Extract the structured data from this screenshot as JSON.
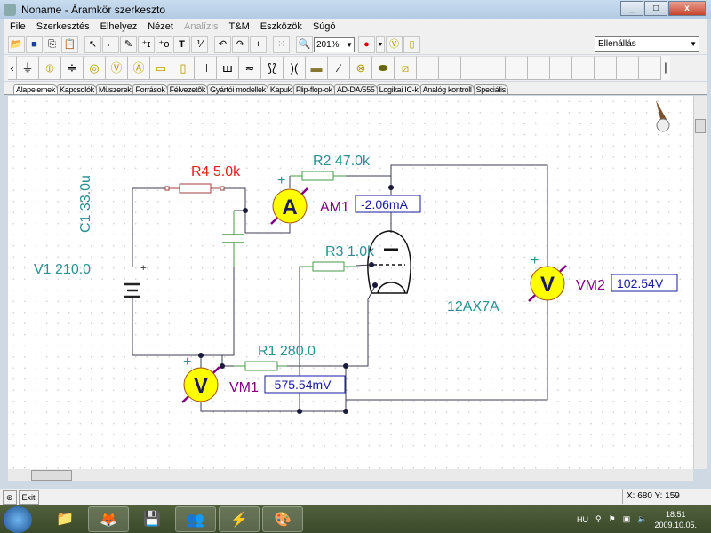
{
  "window": {
    "title": "Noname - Áramkör szerkeszto"
  },
  "menu": [
    "File",
    "Szerkesztés",
    "Elhelyez",
    "Nézet",
    "Analízis",
    "T&M",
    "Eszközök",
    "Súgó"
  ],
  "menu_disabled": [
    "Analízis"
  ],
  "toolbar": {
    "zoom": "201%",
    "component_select": "Ellenállás"
  },
  "component_tabs": [
    "Alapelemek",
    "Kapcsolók",
    "Müszerek",
    "Források",
    "Félvezetõk",
    "Gyártói modellek",
    "Kapuk",
    "Flip-flop-ok",
    "AD-DA/555",
    "Logikai IC-k",
    "Analóg kontroll",
    "Speciális"
  ],
  "active_tab": "Alapelemek",
  "circuit": {
    "R4": "R4 5.0k",
    "R2": "R2 47.0k",
    "R3": "R3 1.0k",
    "R1": "R1 280.0",
    "C1": "C1 33.0u",
    "V1": "V1 210.0",
    "tube": "12AX7A",
    "AM1": {
      "label": "AM1",
      "value": "-2.06mA",
      "symbol": "A"
    },
    "VM1": {
      "label": "VM1",
      "value": "-575.54mV",
      "symbol": "V"
    },
    "VM2": {
      "label": "VM2",
      "value": "102.54V",
      "symbol": "V"
    },
    "colors": {
      "wire": "#3c3c50",
      "component_label": "#2a9090",
      "selected_label": "#e02020",
      "meter_label": "#800080",
      "value_text": "#1a1aa0",
      "meter_fill": "#ffff00"
    }
  },
  "status": {
    "exit": "Exit",
    "coords": "X: 680  Y: 159"
  },
  "taskbar": {
    "lang": "HU",
    "time": "18:51",
    "date": "2009.10.05."
  }
}
